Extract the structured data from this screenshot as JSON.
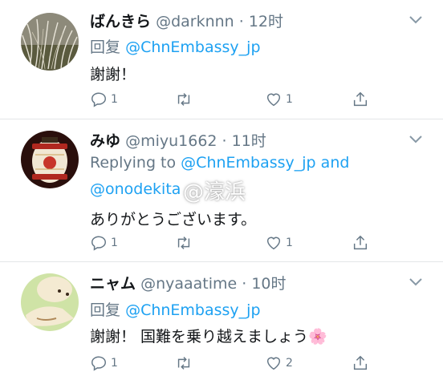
{
  "tweets": [
    {
      "name": "ばんきら",
      "handle": "@darknnn",
      "time": "· 12时",
      "reply_prefix": "回复",
      "reply_to": "@ChnEmbassy_jp",
      "text": "謝謝！",
      "replies": "1",
      "retweets": "",
      "likes": "1"
    },
    {
      "name": "みゆ",
      "handle": "@miyu1662",
      "time": "· 11时",
      "reply_prefix": "Replying to",
      "reply_to": "@ChnEmbassy_jp",
      "reply_and": "and",
      "reply_to2": "@onodekita",
      "text": "ありがとうございます。",
      "replies": "1",
      "retweets": "",
      "likes": "1"
    },
    {
      "name": "ニャム",
      "handle": "@nyaaatime",
      "time": "· 10时",
      "reply_prefix": "回复",
      "reply_to": "@ChnEmbassy_jp",
      "text": "謝謝！ 国難を乗り越えましょう",
      "emoji": "🌸",
      "replies": "1",
      "retweets": "",
      "likes": "2"
    }
  ],
  "watermark": "@濠浜",
  "colors": {
    "link": "#1da1f2",
    "muted": "#657786",
    "divider": "#e3e6e8"
  },
  "icons": [
    "reply-icon",
    "retweet-icon",
    "like-icon",
    "share-icon",
    "chevron-down-icon"
  ]
}
